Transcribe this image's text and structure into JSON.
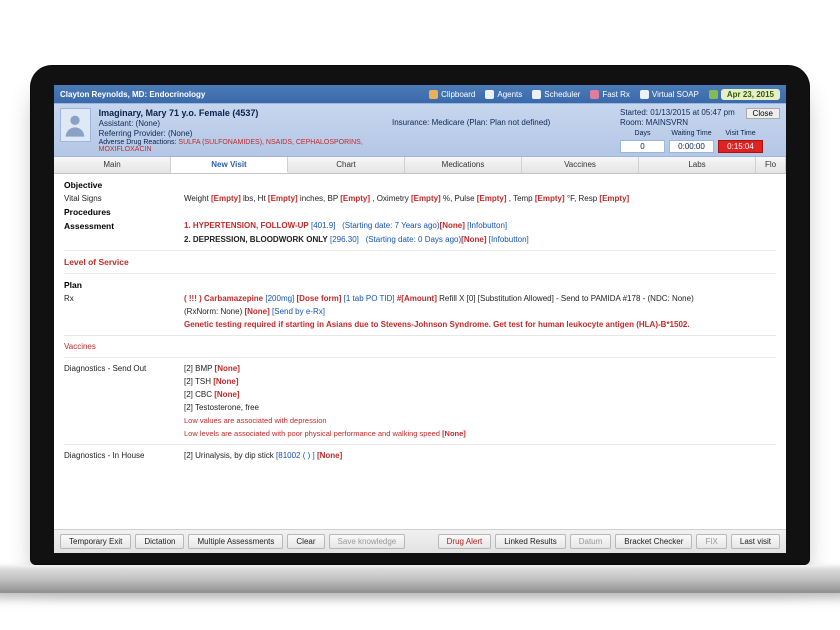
{
  "titlebar": {
    "title": "Clayton Reynolds, MD: Endocrinology",
    "items": [
      "Clipboard",
      "Agents",
      "Scheduler",
      "Fast Rx",
      "Virtual SOAP"
    ],
    "date": "Apr 23, 2015"
  },
  "banner": {
    "patient": "Imaginary, Mary 71 y.o. Female (4537)",
    "assistant": "Assistant: (None)",
    "referring": "Referring Provider: (None)",
    "adr_label": "Adverse Drug Reactions:",
    "adr_value": "SULFA (SULFONAMIDES), NSAIDS, CEPHALOSPORINS, MOXIFLOXACIN",
    "insurance": "Insurance: Medicare (Plan: Plan not  defined)",
    "started": "Started: 01/13/2015 at 05:47 pm",
    "room": "Room: MAINSVRN",
    "close": "Close",
    "col_labels": [
      "Days",
      "Waiting Time",
      "Visit Time"
    ],
    "col_values": [
      "0",
      "0:00:00",
      "0:15:04"
    ]
  },
  "tabs": [
    "Main",
    "New Visit",
    "Chart",
    "Medications",
    "Vaccines",
    "Labs",
    "Flo"
  ],
  "active_tab_index": 1,
  "sections": {
    "objective": "Objective",
    "vitals_label": "Vital Signs",
    "vitals_text": [
      "Weight ",
      " lbs, Ht ",
      " inches, BP ",
      " , Oximetry ",
      " %, Pulse ",
      " , Temp ",
      " °F, Resp ",
      ""
    ],
    "empty": "[Empty]",
    "procedures": "Procedures",
    "assessment": "Assessment",
    "assess_1_no": "1.",
    "assess_1_dx": "HYPERTENSION, FOLLOW-UP",
    "assess_1_code": "[401.9]",
    "assess_1_meta": "(Starting date: 7 Years ago)",
    "assess_1_none": "[None]",
    "assess_1_btn": "[Infobutton]",
    "assess_2_no": "2.",
    "assess_2_dx": "DEPRESSION, BLOODWORK ONLY",
    "assess_2_code": "[296.30]",
    "assess_2_meta": "(Starting date: 0 Days ago)",
    "assess_2_none": "[None]",
    "assess_2_btn": "[Infobutton]",
    "los": "Level of Service",
    "plan": "Plan",
    "rx_label": "Rx",
    "rx_pre": "( !!! )",
    "rx_drug": "Carbamazepine",
    "rx_dose": "[200mg]",
    "rx_form": "[Dose form]",
    "rx_sig": "[1 tab PO TID]",
    "rx_amt": "#[Amount]",
    "rx_refill": "Refill X [0] [Substitution Allowed] - Send to PAMIDA #178 - (NDC: None)",
    "rx_line2_a": "(RxNorm: None)",
    "rx_line2_b": "[None]",
    "rx_line2_c": "[Send by e-Rx]",
    "rx_warn": "Genetic testing required if starting in Asians due to Stevens-Johnson Syndrome. Get test for human leukocyte antigen (HLA)-B*1502.",
    "vaccines": "Vaccines",
    "dx_out": "Diagnostics - Send Out",
    "dx_out_items": [
      "[2] BMP ",
      "[2] TSH ",
      "[2] CBC ",
      "[2] Testosterone, free"
    ],
    "dx_out_note1": "Low values are associated with depression",
    "dx_out_note2": "Low levels are associated with poor physical performance and walking speed ",
    "none_sq": "[None]",
    "dx_in": "Diagnostics - In House",
    "dx_in_item": "[2] Urinalysis, by dip stick  ",
    "dx_in_code": "[81002  ( ) ]"
  },
  "buttons": {
    "left": [
      "Temporary Exit",
      "Dictation",
      "Multiple Assessments",
      "Clear",
      "Save knowledge"
    ],
    "right": [
      "Drug Alert",
      "Linked Results",
      "Datum",
      "Bracket Checker",
      "FIX",
      "Last visit"
    ]
  }
}
